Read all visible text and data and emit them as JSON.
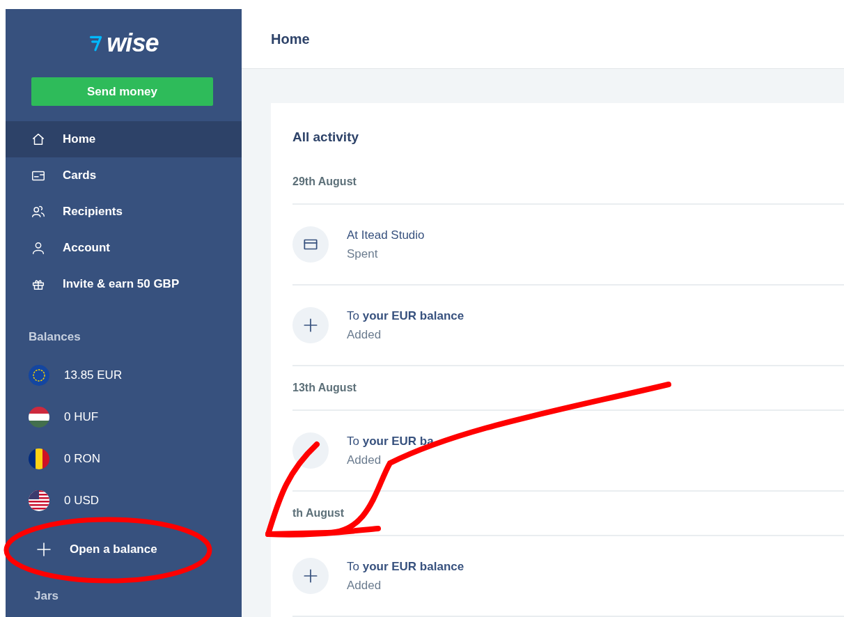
{
  "sidebar": {
    "logo": {
      "text": "wise"
    },
    "send_button": {
      "label": "Send money"
    },
    "nav": [
      {
        "label": "Home",
        "kind": "home",
        "selected": true
      },
      {
        "label": "Cards",
        "kind": "card",
        "selected": false
      },
      {
        "label": "Recipients",
        "kind": "people",
        "selected": false
      },
      {
        "label": "Account",
        "kind": "person",
        "selected": false
      },
      {
        "label": "Invite & earn 50 GBP",
        "kind": "gift",
        "selected": false
      }
    ],
    "balances_heading": "Balances",
    "balances": [
      {
        "amount": "13.85 EUR",
        "kind": "eu"
      },
      {
        "amount": "0 HUF",
        "kind": "hu"
      },
      {
        "amount": "0 RON",
        "kind": "ro"
      },
      {
        "amount": "0 USD",
        "kind": "us"
      }
    ],
    "open_balance": {
      "label": "Open a balance"
    },
    "jars_heading": "Jars"
  },
  "header": {
    "title": "Home"
  },
  "activity": {
    "title": "All activity",
    "groups": [
      {
        "date": "29th August",
        "items": [
          {
            "title": "At Itead Studio",
            "subtitle": "Spent",
            "kind": "card"
          },
          {
            "title": "To **your EUR balance**",
            "subtitle": "Added",
            "kind": "plus"
          }
        ]
      },
      {
        "date": "13th August",
        "items": [
          {
            "title": "To **your EUR ba**",
            "subtitle": "Added"
          }
        ]
      },
      {
        "date": "th August",
        "items": [
          {
            "title": "To **your EUR balance**",
            "subtitle": "Added",
            "kind": "plus"
          }
        ]
      }
    ]
  }
}
